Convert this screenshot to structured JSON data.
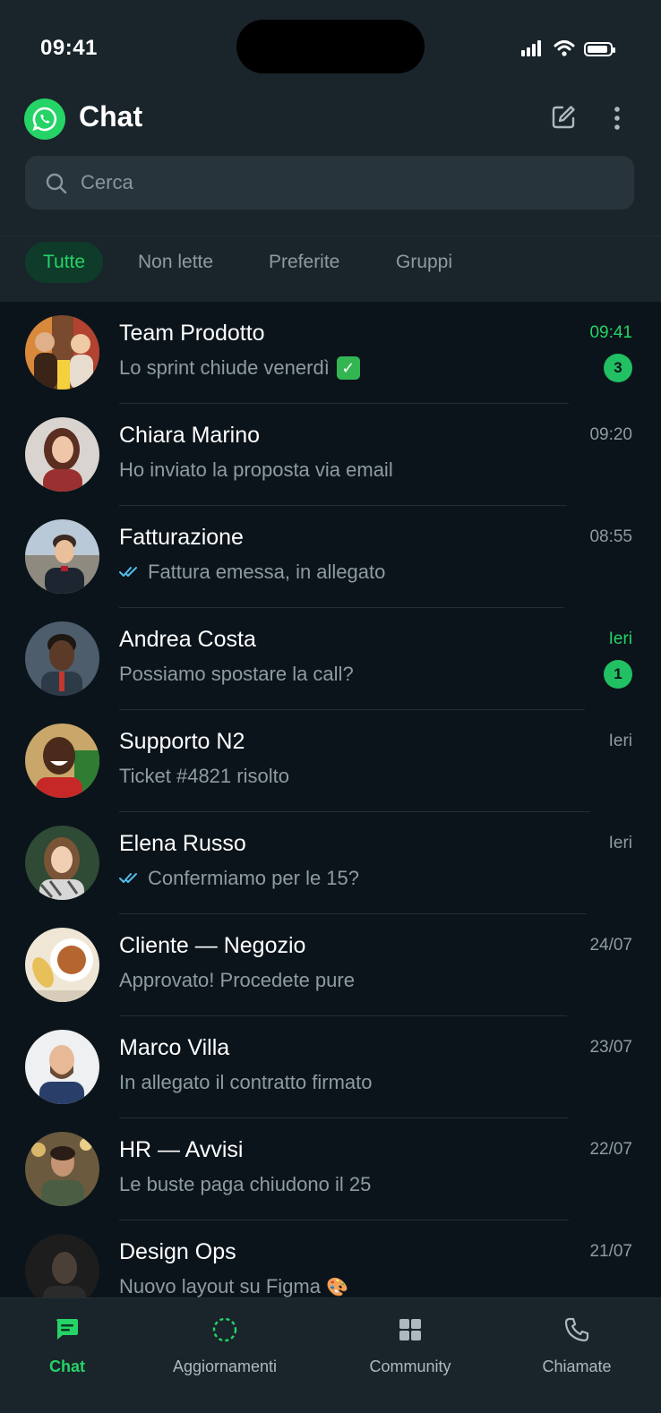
{
  "status_bar": {
    "time": "09:41"
  },
  "header": {
    "title": "Chat"
  },
  "search": {
    "placeholder": "Cerca",
    "value": ""
  },
  "filters": [
    {
      "label": "Tutte",
      "active": true
    },
    {
      "label": "Non lette",
      "active": false
    },
    {
      "label": "Preferite",
      "active": false
    },
    {
      "label": "Gruppi",
      "active": false
    }
  ],
  "chats": [
    {
      "name": "Team Prodotto",
      "message": "Lo sprint chiude venerdì",
      "time": "09:41",
      "unread": "3"
    },
    {
      "name": "Chiara Marino",
      "message": "Ho inviato la proposta via email",
      "time": "09:20"
    },
    {
      "name": "Fatturazione",
      "message": "Fattura emessa, in allegato",
      "time": "08:55"
    },
    {
      "name": "Andrea Costa",
      "message": "Possiamo spostare la call?",
      "time": "Ieri",
      "unread": "1"
    },
    {
      "name": "Supporto N2",
      "message": "Ticket #4821 risolto",
      "time": "Ieri"
    },
    {
      "name": "Elena Russo",
      "message": "Confermiamo per le 15?",
      "time": "Ieri"
    },
    {
      "name": "Cliente — Negozio",
      "message": "Approvato! Procedete pure",
      "time": "24/07"
    },
    {
      "name": "Marco Villa",
      "message": "In allegato il contratto firmato",
      "time": "23/07"
    },
    {
      "name": "HR — Avvisi",
      "message": "Le buste paga chiudono il 25",
      "time": "22/07"
    },
    {
      "name": "Design Ops",
      "message": "Nuovo layout su Figma",
      "time": "21/07"
    }
  ],
  "tabbar": [
    {
      "label": "Chat",
      "icon": "chat-icon",
      "active": true
    },
    {
      "label": "Aggiornamenti",
      "icon": "status-icon",
      "active": false
    },
    {
      "label": "Community",
      "icon": "community-icon",
      "active": false
    },
    {
      "label": "Chiamate",
      "icon": "phone-icon",
      "active": false
    }
  ],
  "colors": {
    "accent": "#25d366",
    "background": "#0b141a",
    "bar": "#1a242b",
    "read_ticks": "#53bdeb"
  }
}
